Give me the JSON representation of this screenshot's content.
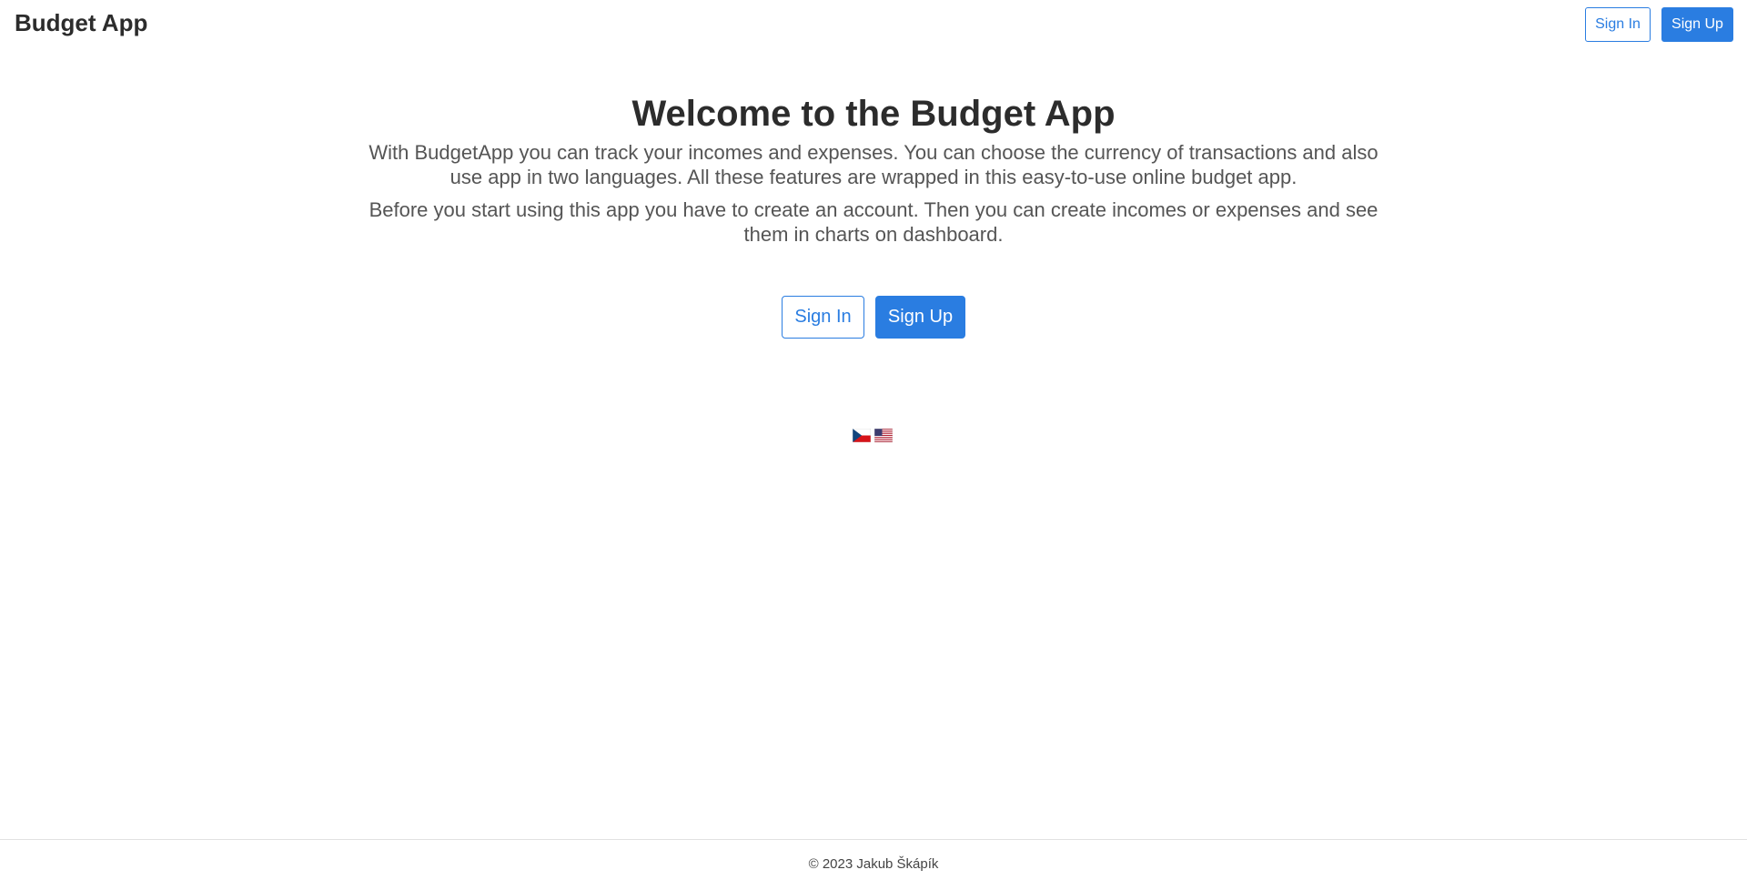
{
  "header": {
    "brand": "Budget App",
    "sign_in_label": "Sign In",
    "sign_up_label": "Sign Up"
  },
  "hero": {
    "title": "Welcome to the Budget App",
    "paragraph1": "With BudgetApp you can track your incomes and expenses. You can choose the currency of transactions and also use app in two languages. All these features are wrapped in this easy-to-use online budget app.",
    "paragraph2": "Before you start using this app you have to create an account. Then you can create incomes or expenses and see them in charts on dashboard.",
    "sign_in_label": "Sign In",
    "sign_up_label": "Sign Up"
  },
  "languages": [
    {
      "icon": "czech-flag-icon"
    },
    {
      "icon": "us-flag-icon"
    }
  ],
  "footer": {
    "copyright": "© 2023 Jakub Škápík"
  },
  "colors": {
    "primary": "#2a7de1",
    "text_dark": "#2c2c2c",
    "text_muted": "#555555"
  }
}
